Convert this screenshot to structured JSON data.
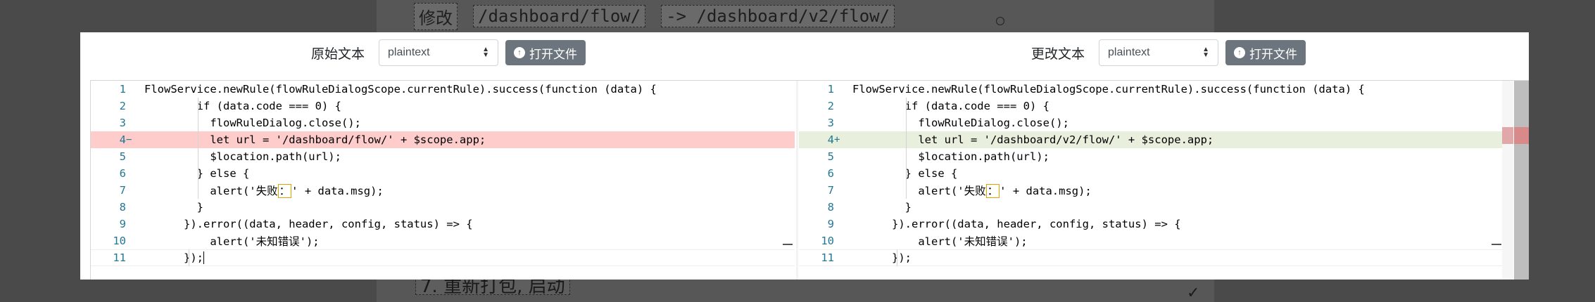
{
  "background": {
    "heading_cn": "修改",
    "heading_from": "/dashboard/flow/",
    "heading_to": "-> /dashboard/v2/flow/",
    "footer_text": "7. 重新打包, 启动",
    "check_icon": "✓"
  },
  "toolbar": {
    "left": {
      "label": "原始文本",
      "language": "plaintext",
      "open_button": "打开文件"
    },
    "right": {
      "label": "更改文本",
      "language": "plaintext",
      "open_button": "打开文件"
    }
  },
  "original": {
    "lines": [
      {
        "num": "1",
        "sign": "",
        "text": "FlowService.newRule(flowRuleDialogScope.currentRule).success(function (data) {"
      },
      {
        "num": "2",
        "sign": "",
        "text": "        if (data.code === 0) {"
      },
      {
        "num": "3",
        "sign": "",
        "text": "          flowRuleDialog.close();"
      },
      {
        "num": "4",
        "sign": "−",
        "text": "          let url = '/dashboard/flow/' + $scope.app;"
      },
      {
        "num": "5",
        "sign": "",
        "text": "          $location.path(url);"
      },
      {
        "num": "6",
        "sign": "",
        "text": "        } else {"
      },
      {
        "num": "7",
        "sign": "",
        "text_before": "          alert('失败",
        "text_hl": "：",
        "text_after": "' + data.msg);"
      },
      {
        "num": "8",
        "sign": "",
        "text": "        }"
      },
      {
        "num": "9",
        "sign": "",
        "text": "      }).error((data, header, config, status) => {"
      },
      {
        "num": "10",
        "sign": "",
        "text": "          alert('未知错误');"
      },
      {
        "num": "11",
        "sign": "",
        "text": "      });"
      }
    ]
  },
  "modified": {
    "lines": [
      {
        "num": "1",
        "sign": "",
        "text": "FlowService.newRule(flowRuleDialogScope.currentRule).success(function (data) {"
      },
      {
        "num": "2",
        "sign": "",
        "text": "        if (data.code === 0) {"
      },
      {
        "num": "3",
        "sign": "",
        "text": "          flowRuleDialog.close();"
      },
      {
        "num": "4",
        "sign": "+",
        "text": "          let url = '/dashboard/v2/flow/' + $scope.app;"
      },
      {
        "num": "5",
        "sign": "",
        "text": "          $location.path(url);"
      },
      {
        "num": "6",
        "sign": "",
        "text": "        } else {"
      },
      {
        "num": "7",
        "sign": "",
        "text_before": "          alert('失败",
        "text_hl": "：",
        "text_after": "' + data.msg);"
      },
      {
        "num": "8",
        "sign": "",
        "text": "        }"
      },
      {
        "num": "9",
        "sign": "",
        "text": "      }).error((data, header, config, status) => {"
      },
      {
        "num": "10",
        "sign": "",
        "text": "          alert('未知错误');"
      },
      {
        "num": "11",
        "sign": "",
        "text": "      });"
      }
    ]
  },
  "icons": {
    "open_file_icon": "arrow-up-circle-icon",
    "select_caret_icon": "updown-caret-icon"
  }
}
